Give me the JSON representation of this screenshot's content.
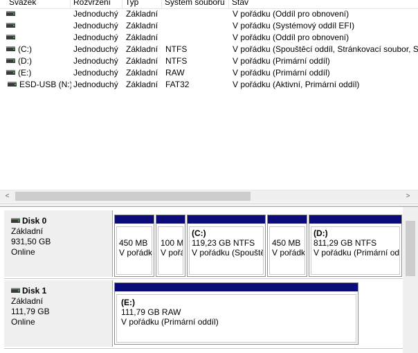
{
  "volume_list": {
    "columns": [
      "Svazek",
      "Rozvržení",
      "Typ",
      "Systém souborů",
      "Stav"
    ],
    "rows": [
      {
        "name": "",
        "layout": "Jednoduchý",
        "type": "Základní",
        "fs": "",
        "status": "V pořádku (Oddíl pro obnovení)"
      },
      {
        "name": "",
        "layout": "Jednoduchý",
        "type": "Základní",
        "fs": "",
        "status": "V pořádku (Systémový oddíl EFI)"
      },
      {
        "name": "",
        "layout": "Jednoduchý",
        "type": "Základní",
        "fs": "",
        "status": "V pořádku (Oddíl pro obnovení)"
      },
      {
        "name": "(C:)",
        "layout": "Jednoduchý",
        "type": "Základní",
        "fs": "NTFS",
        "status": "V pořádku (Spouštěcí oddíl, Stránkovací soubor, St"
      },
      {
        "name": "(D:)",
        "layout": "Jednoduchý",
        "type": "Základní",
        "fs": "NTFS",
        "status": "V pořádku (Primární oddíl)"
      },
      {
        "name": "(E:)",
        "layout": "Jednoduchý",
        "type": "Základní",
        "fs": "RAW",
        "status": "V pořádku (Primární oddíl)"
      },
      {
        "name": "ESD-USB (N:)",
        "layout": "Jednoduchý",
        "type": "Základní",
        "fs": "FAT32",
        "status": "V pořádku (Aktivní, Primární oddíl)"
      }
    ]
  },
  "scrollbar": {
    "left_arrow": "<",
    "right_arrow": ">"
  },
  "disks": [
    {
      "name": "Disk 0",
      "kind": "Základní",
      "size": "931,50 GB",
      "state": "Online",
      "partitions": [
        {
          "letter": "",
          "size": "450 MB",
          "status": "V pořádku (Oddíl pro obnovení)"
        },
        {
          "letter": "",
          "size": "100 MB",
          "status": "V pořádku (Systémový oddíl EFI)"
        },
        {
          "letter": "(C:)",
          "size": "119,23 GB NTFS",
          "status": "V pořádku (Spouštěcí oddíl, Stránkovací soubor)"
        },
        {
          "letter": "",
          "size": "450 MB",
          "status": "V pořádku (Oddíl pro obnovení)"
        },
        {
          "letter": "(D:)",
          "size": "811,29 GB NTFS",
          "status": "V pořádku (Primární oddíl)"
        }
      ]
    },
    {
      "name": "Disk 1",
      "kind": "Základní",
      "size": "111,79 GB",
      "state": "Online",
      "partitions": [
        {
          "letter": "(E:)",
          "size": "111,79 GB RAW",
          "status": "V pořádku (Primární oddíl)"
        }
      ]
    }
  ]
}
